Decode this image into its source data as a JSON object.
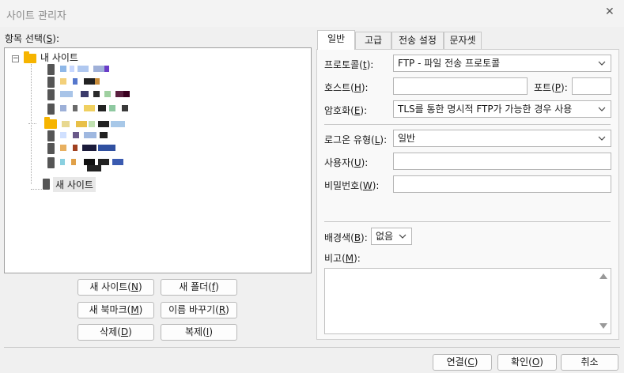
{
  "window": {
    "title": "사이트 관리자"
  },
  "left": {
    "label_prefix": "항목 선택(",
    "label_key": "S",
    "label_suffix": "):",
    "tree": {
      "root": "내 사이트",
      "new_site": "새 사이트"
    },
    "buttons": {
      "new_site": {
        "text": "새 사이트(",
        "key": "N",
        "end": ")"
      },
      "new_folder": {
        "text": "새 폴더(",
        "key": "f",
        "end": ")"
      },
      "new_bookmark": {
        "text": "새 북마크(",
        "key": "M",
        "end": ")"
      },
      "rename": {
        "text": "이름 바꾸기(",
        "key": "R",
        "end": ")"
      },
      "delete": {
        "text": "삭제(",
        "key": "D",
        "end": ")"
      },
      "duplicate": {
        "text": "복제(",
        "key": "I",
        "end": ")"
      }
    }
  },
  "tabs": [
    "일반",
    "고급",
    "전송 설정",
    "문자셋"
  ],
  "general": {
    "protocol": {
      "label": "프로토콜(",
      "key": "t",
      "end": "):",
      "value": "FTP - 파일 전송 프로토콜"
    },
    "host": {
      "label": "호스트(",
      "key": "H",
      "end": "):",
      "value": ""
    },
    "port": {
      "label": "포트(",
      "key": "P",
      "end": "):",
      "value": ""
    },
    "encryption": {
      "label": "암호화(",
      "key": "E",
      "end": "):",
      "value": "TLS를 통한 명시적 FTP가 가능한 경우 사용"
    },
    "logon_type": {
      "label": "로그온 유형(",
      "key": "L",
      "end": "):",
      "value": "일반"
    },
    "user": {
      "label": "사용자(",
      "key": "U",
      "end": "):",
      "value": ""
    },
    "password": {
      "label": "비밀번호(",
      "key": "W",
      "end": "):",
      "value": ""
    },
    "background": {
      "label": "배경색(",
      "key": "B",
      "end": "):",
      "value": "없음"
    },
    "comments": {
      "label": "비고(",
      "key": "M",
      "end": "):",
      "value": ""
    }
  },
  "footer": {
    "connect": {
      "text": "연결(",
      "key": "C",
      "end": ")"
    },
    "ok": {
      "text": "확인(",
      "key": "O",
      "end": ")"
    },
    "cancel": {
      "text": "취소"
    }
  },
  "colors": {
    "folder": "#f6b400",
    "selection": "#e8e8e8"
  }
}
